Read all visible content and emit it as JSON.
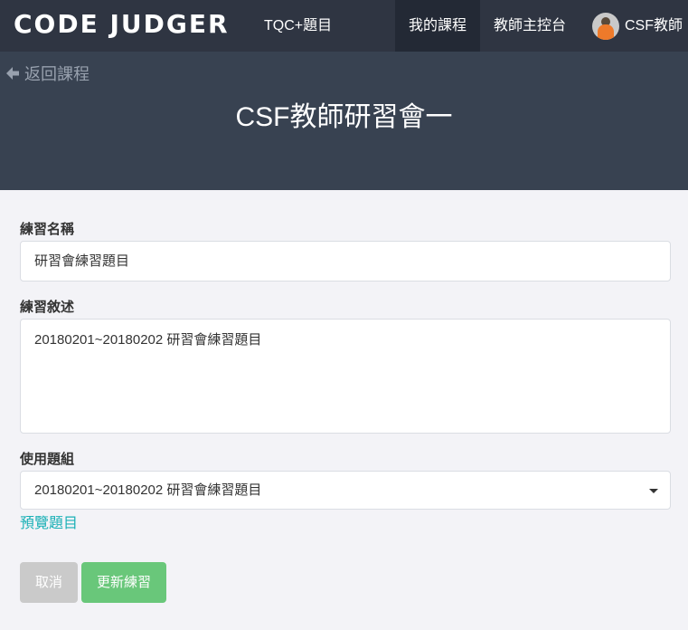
{
  "navbar": {
    "brand": "CODE JUDGER",
    "tqc_link": "TQC+題目",
    "my_courses": "我的課程",
    "teacher_console": "教師主控台",
    "user_name": "CSF教師"
  },
  "hero": {
    "back_label": "返回課程",
    "title": "CSF教師研習會一"
  },
  "form": {
    "name_label": "練習名稱",
    "name_value": "研習會練習題目",
    "desc_label": "練習敘述",
    "desc_value": "20180201~20180202 研習會練習題目",
    "group_label": "使用題組",
    "group_value": "20180201~20180202 研習會練習題目",
    "preview_link": "預覽題目",
    "cancel_label": "取消",
    "update_label": "更新練習"
  },
  "colors": {
    "navbar_bg": "#2f3542",
    "hero_bg": "#384251",
    "link": "#1ab0b6",
    "update_button": "#69c77a",
    "cancel_button": "#cacaca"
  }
}
